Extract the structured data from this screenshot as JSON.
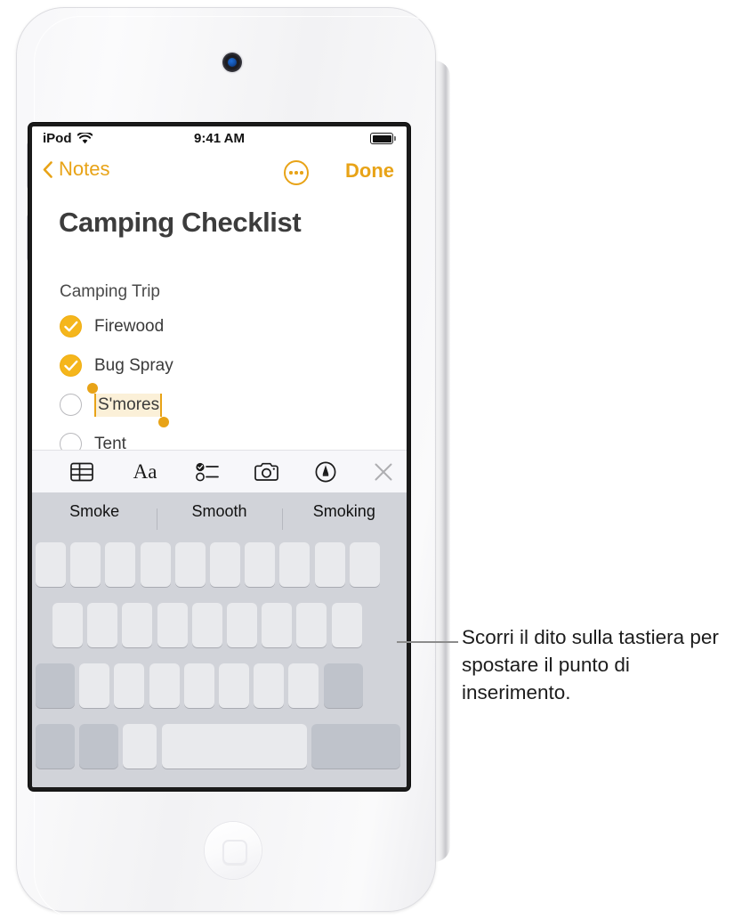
{
  "device": {
    "name": "iPod touch",
    "camera_icon": "camera-lens",
    "home_button_icon": "home-square-icon",
    "side_buttons": [
      "volume-up",
      "volume-down"
    ]
  },
  "status_bar": {
    "carrier": "iPod",
    "wifi_icon": "wifi-icon",
    "time": "9:41 AM",
    "battery_icon": "battery-full-icon"
  },
  "nav_bar": {
    "back_label": "Notes",
    "back_icon": "chevron-left-icon",
    "more_icon": "ellipsis-circle-icon",
    "done_label": "Done"
  },
  "note": {
    "title": "Camping Checklist",
    "subtitle": "Camping Trip",
    "items": [
      {
        "label": "Firewood",
        "checked": true,
        "selected": false
      },
      {
        "label": "Bug Spray",
        "checked": true,
        "selected": false
      },
      {
        "label": "S'mores",
        "checked": false,
        "selected": true
      },
      {
        "label": "Tent",
        "checked": false,
        "selected": false
      }
    ]
  },
  "toolbar": {
    "items": [
      {
        "name": "table-icon",
        "label": "Table"
      },
      {
        "name": "format-icon",
        "label": "Aa"
      },
      {
        "name": "checklist-icon",
        "label": "Checklist"
      },
      {
        "name": "camera-icon",
        "label": "Camera"
      },
      {
        "name": "markup-icon",
        "label": "Markup"
      },
      {
        "name": "close-icon",
        "label": "Close"
      }
    ],
    "format_label": "Aa"
  },
  "suggestions": [
    "Smoke",
    "Smooth",
    "Smoking"
  ],
  "keyboard": {
    "rows": [
      {
        "keys": 10,
        "dark_indices": []
      },
      {
        "keys": 9,
        "dark_indices": []
      },
      {
        "keys": 9,
        "dark_indices": [
          0,
          8
        ]
      },
      {
        "keys": 5,
        "dark_indices": [
          0,
          1,
          4
        ]
      }
    ]
  },
  "callout": {
    "text": "Scorri il dito sulla tastiera per spostare il punto di inserimento."
  },
  "colors": {
    "accent": "#e8a317",
    "check_fill": "#f5b61c",
    "selection_bg": "#fbf0d8",
    "keyboard_bg": "#d1d3d9",
    "key_light": "#e9eaed",
    "key_dark": "#bfc3cb",
    "toolbar_bg": "#f7f7fa",
    "title_color": "#3c3c3c"
  }
}
